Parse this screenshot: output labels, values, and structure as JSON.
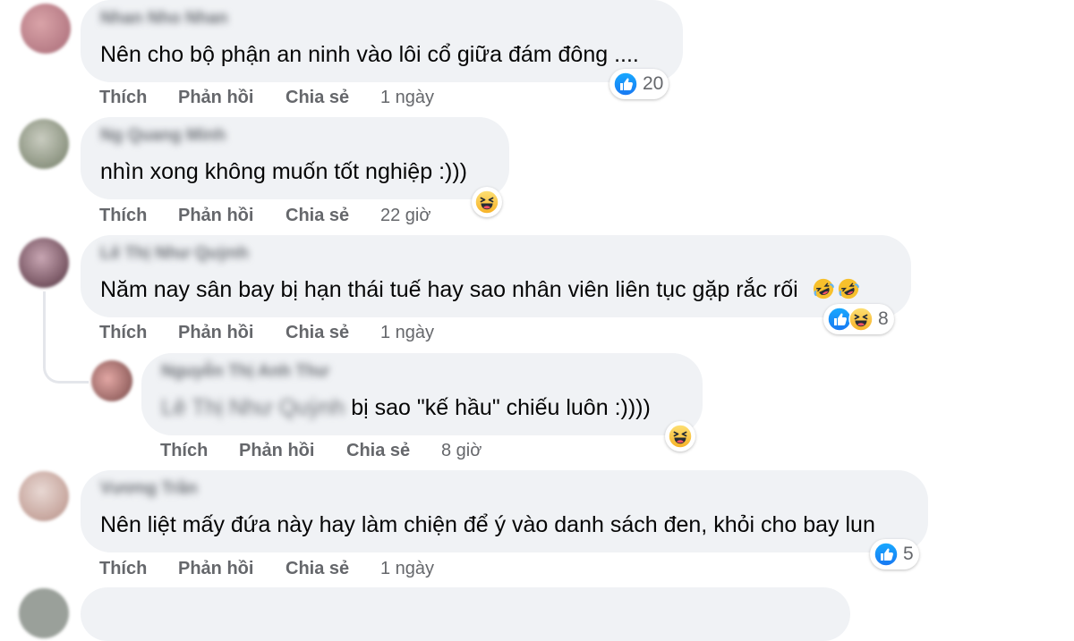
{
  "comments": [
    {
      "author": "Nhan Nho Nhan",
      "text": "Nên cho bộ phận an ninh vào lôi cổ giữa đám đông ....",
      "actions": {
        "like": "Thích",
        "reply": "Phản hồi",
        "share": "Chia sẻ",
        "time": "1 ngày"
      },
      "reactions": {
        "icons": [
          "like-icon"
        ],
        "count": "20"
      }
    },
    {
      "author": "Ng Quang Minh",
      "text": "nhìn xong không muốn tốt nghiệp :)))",
      "actions": {
        "like": "Thích",
        "reply": "Phản hồi",
        "share": "Chia sẻ",
        "time": "22 giờ"
      },
      "reactions": {
        "icons": [
          "haha-icon"
        ],
        "count": ""
      }
    },
    {
      "author": "Lê Thị Như Quỳnh",
      "text": "Năm nay sân bay bị hạn thái tuế hay sao nhân viên liên tục gặp rắc rối",
      "emoji": [
        "rofl-emoji",
        "rofl-emoji"
      ],
      "actions": {
        "like": "Thích",
        "reply": "Phản hồi",
        "share": "Chia sẻ",
        "time": "1 ngày"
      },
      "reactions": {
        "icons": [
          "like-icon",
          "haha-icon"
        ],
        "count": "8"
      }
    },
    {
      "author": "Nguyễn Thị Anh Thư",
      "mention": "Lê Thị Như Quỳnh",
      "text": " bị sao \"kế hầu\" chiếu luôn :))))",
      "actions": {
        "like": "Thích",
        "reply": "Phản hồi",
        "share": "Chia sẻ",
        "time": "8 giờ"
      },
      "reactions": {
        "icons": [
          "haha-icon"
        ],
        "count": ""
      }
    },
    {
      "author": "Vương Trần",
      "text": "Nên liệt mấy đứa này hay làm chiện để ý vào danh sách đen, khỏi cho bay lun",
      "actions": {
        "like": "Thích",
        "reply": "Phản hồi",
        "share": "Chia sẻ",
        "time": "1 ngày"
      },
      "reactions": {
        "icons": [
          "like-icon"
        ],
        "count": "5"
      }
    }
  ],
  "colors": {
    "bubble": "#f0f2f5",
    "like_blue": "#1877f2",
    "haha_yellow": "#f7b928",
    "meta_gray": "#65676b"
  }
}
